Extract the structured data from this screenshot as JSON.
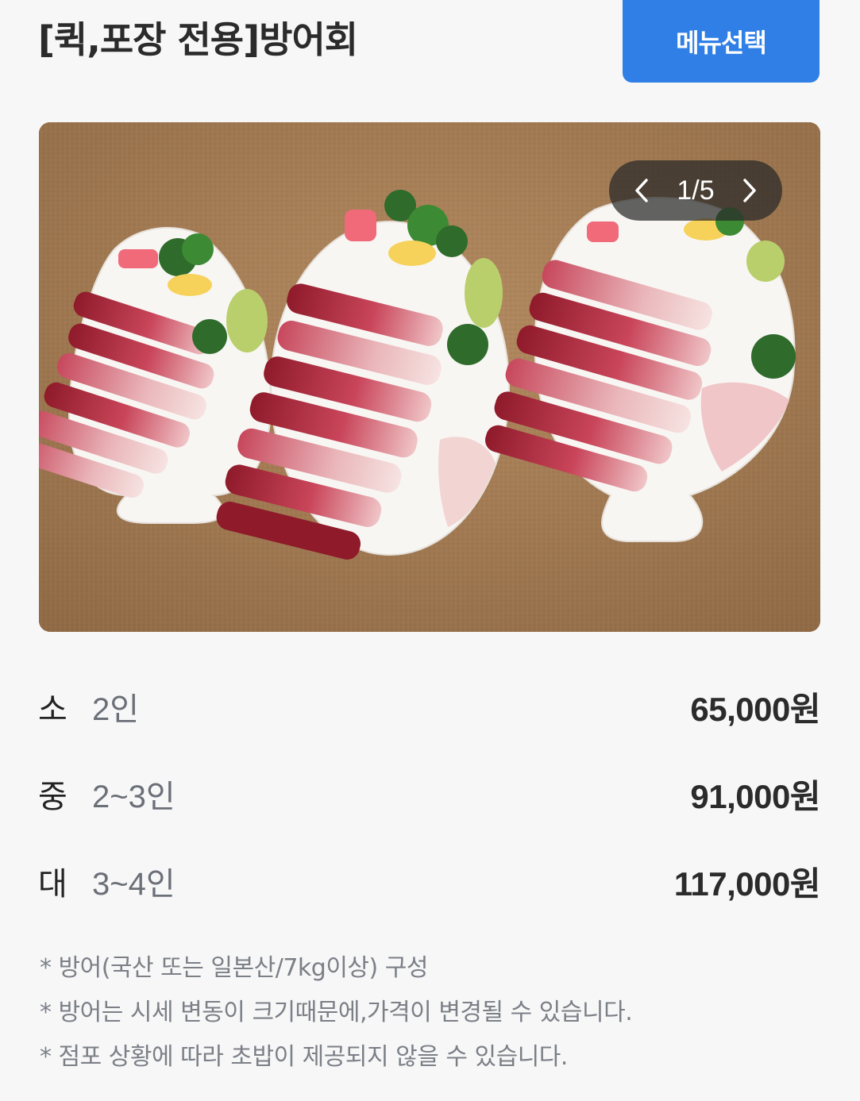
{
  "header": {
    "title": "[퀵,포장 전용]방어회",
    "menu_button_label": "메뉴선택",
    "button_color": "#2f7fe6"
  },
  "gallery": {
    "current": 1,
    "total": 5,
    "counter_text": "1/5",
    "prev_icon": "chevron-left-icon",
    "next_icon": "chevron-right-icon",
    "image_subject": "방어회"
  },
  "prices": [
    {
      "size": "소",
      "people": "2인",
      "price": "65,000",
      "unit": "원"
    },
    {
      "size": "중",
      "people": "2~3인",
      "price": "91,000",
      "unit": "원"
    },
    {
      "size": "대",
      "people": "3~4인",
      "price": "117,000",
      "unit": "원"
    }
  ],
  "notes": [
    "* 방어(국산 또는 일본산/7kg이상) 구성",
    "* 방어는 시세 변동이 크기때문에,가격이 변경될 수 있습니다.",
    "* 점포 상황에 따라 초밥이 제공되지 않을 수 있습니다."
  ]
}
